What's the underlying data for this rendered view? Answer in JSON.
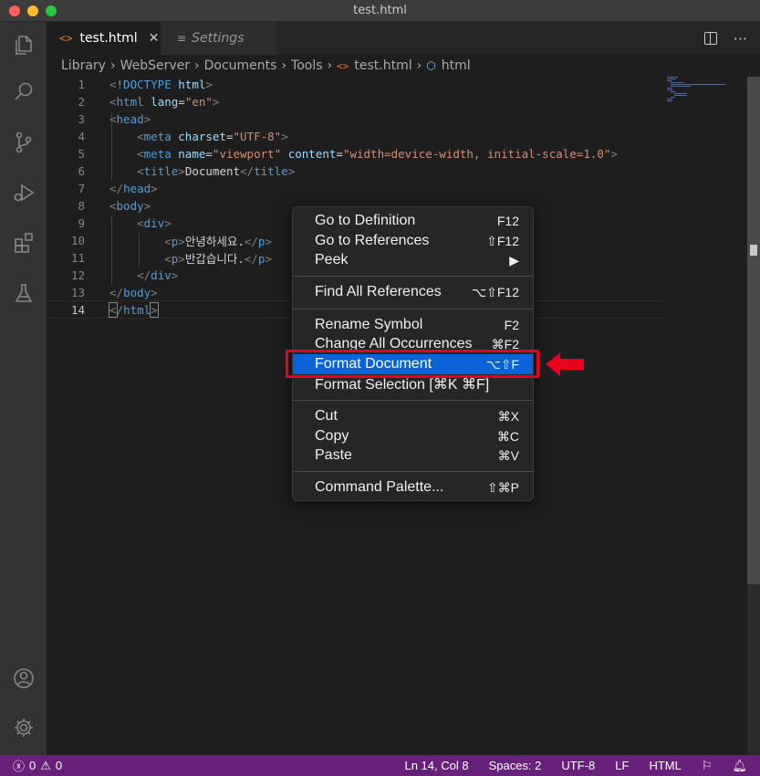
{
  "window": {
    "title": "test.html"
  },
  "tabs": [
    {
      "label": "test.html",
      "active": true
    },
    {
      "label": "Settings",
      "active": false
    }
  ],
  "breadcrumb": [
    "Library",
    "WebServer",
    "Documents",
    "Tools",
    "test.html",
    "html"
  ],
  "editor": {
    "line_numbers": [
      "1",
      "2",
      "3",
      "4",
      "5",
      "6",
      "7",
      "8",
      "9",
      "10",
      "11",
      "12",
      "13",
      "14"
    ],
    "current_line": 14
  },
  "context_menu": {
    "items": [
      {
        "label": "Go to Definition",
        "shortcut": "F12"
      },
      {
        "label": "Go to References",
        "shortcut": "⇧F12"
      },
      {
        "label": "Peek",
        "shortcut": "▶"
      },
      {
        "label": "Find All References",
        "shortcut": "⌥⇧F12"
      },
      {
        "label": "Rename Symbol",
        "shortcut": "F2"
      },
      {
        "label": "Change All Occurrences",
        "shortcut": "⌘F2"
      },
      {
        "label": "Format Document",
        "shortcut": "⌥⇧F",
        "highlighted": true
      },
      {
        "label": "Format Selection [⌘K ⌘F]",
        "shortcut": ""
      },
      {
        "label": "Cut",
        "shortcut": "⌘X"
      },
      {
        "label": "Copy",
        "shortcut": "⌘C"
      },
      {
        "label": "Paste",
        "shortcut": "⌘V"
      },
      {
        "label": "Command Palette...",
        "shortcut": "⇧⌘P"
      }
    ]
  },
  "statusbar": {
    "errors": "0",
    "warnings": "0",
    "position": "Ln 14, Col 8",
    "spaces": "Spaces: 2",
    "encoding": "UTF-8",
    "eol": "LF",
    "language": "HTML"
  },
  "colors": {
    "accent_statusbar": "#68217a",
    "menu_highlight": "#0a64d8",
    "annotation_red": "#e8001c"
  },
  "icons": [
    "explorer-icon",
    "search-icon",
    "source-control-icon",
    "run-debug-icon",
    "extensions-icon",
    "testing-icon",
    "account-icon",
    "manage-gear-icon"
  ]
}
